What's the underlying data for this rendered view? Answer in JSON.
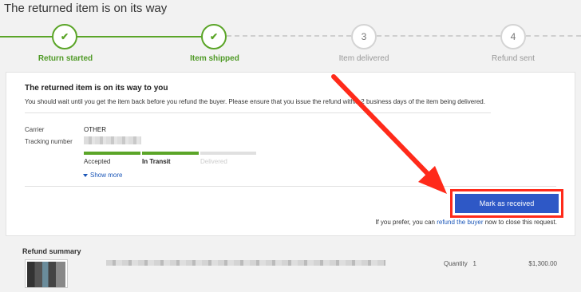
{
  "page": {
    "title": "The returned item is on its way"
  },
  "stepper": {
    "steps": [
      {
        "number": "",
        "label": "Return started",
        "status": "done"
      },
      {
        "number": "",
        "label": "Item shipped",
        "status": "done"
      },
      {
        "number": "3",
        "label": "Item delivered",
        "status": "todo"
      },
      {
        "number": "4",
        "label": "Refund sent",
        "status": "todo"
      }
    ]
  },
  "card": {
    "title": "The returned item is on its way to you",
    "description": "You should wait until you get the item back before you refund the buyer. Please ensure that you issue the refund within 2 business days of the item being delivered.",
    "carrier_label": "Carrier",
    "carrier_value": "OTHER",
    "tracking_label": "Tracking number",
    "shipment_states": [
      "Accepted",
      "In Transit",
      "Delivered"
    ],
    "show_more": "Show more",
    "mark_received_button": "Mark as received",
    "prefer_text": "If you prefer, you can",
    "prefer_link": "refund the buyer",
    "prefer_tail": "now to close this request."
  },
  "refund_summary": {
    "title": "Refund summary",
    "quantity_label": "Quantity",
    "quantity_value": "1",
    "amount": "$1,300.00"
  },
  "colors": {
    "success": "#5ba528",
    "primary_button": "#2e58c6",
    "annotation": "#ff2a1a",
    "link": "#1a56b8"
  }
}
